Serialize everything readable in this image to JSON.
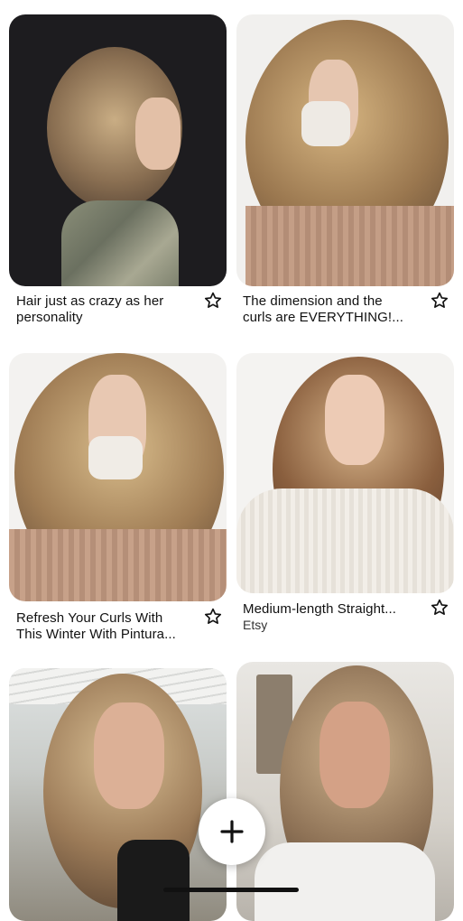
{
  "pins": [
    {
      "title_line1": "Hair just as crazy as her",
      "title_line2": "personality",
      "image_icon": "curly-hair-profile-photo"
    },
    {
      "title_line1": "The dimension and the",
      "title_line2": "curls are EVERYTHING!...",
      "image_icon": "curly-hair-mask-photo"
    },
    {
      "title_line1": "Refresh Your Curls With",
      "title_line2": "This Winter With Pintura...",
      "image_icon": "curly-hair-mask-front-photo"
    },
    {
      "title_line1": "Medium-length Straight...",
      "source": "Etsy",
      "image_icon": "balayage-waves-photo"
    },
    {
      "image_icon": "blonde-balayage-photo"
    },
    {
      "image_icon": "beach-waves-photo"
    }
  ],
  "save_icon": "star-outline-icon",
  "create_button_icon": "plus-icon"
}
